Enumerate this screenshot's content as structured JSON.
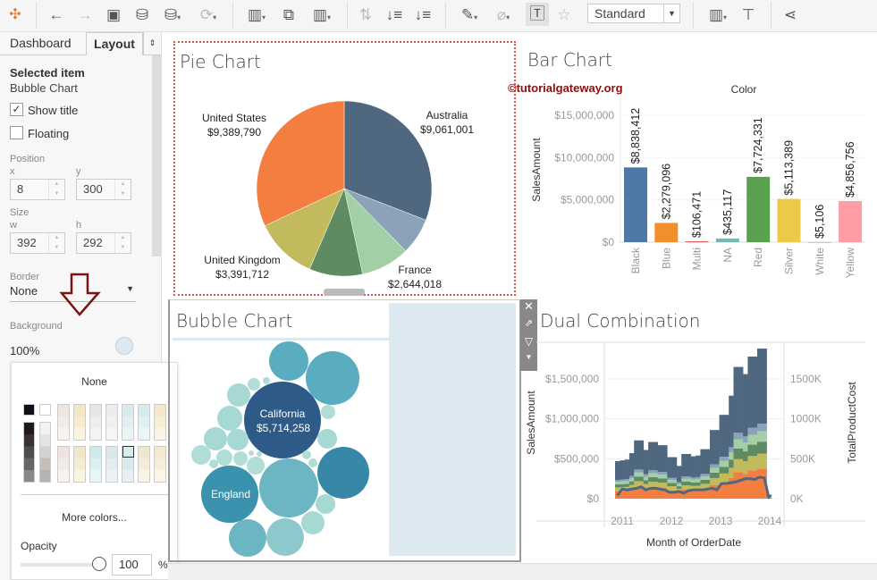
{
  "toolbar": {
    "view_mode": "Standard",
    "icons": [
      "tableau-logo",
      "back",
      "forward",
      "save",
      "new-datasource",
      "pause-updates",
      "refresh",
      "new-worksheet",
      "duplicate",
      "clear",
      "swap",
      "sort-asc",
      "sort-desc",
      "highlight",
      "annotate",
      "show-labels",
      "pin",
      "show-me",
      "presentation",
      "share"
    ]
  },
  "left_panel": {
    "tabs": [
      "Dashboard",
      "Layout"
    ],
    "selected_label": "Selected item",
    "selected_value": "Bubble Chart",
    "show_title": "Show title",
    "show_title_checked": true,
    "floating": "Floating",
    "floating_checked": false,
    "position_label": "Position",
    "x_label": "x",
    "y_label": "y",
    "x": "8",
    "y": "300",
    "size_label": "Size",
    "w_label": "w",
    "h_label": "h",
    "w": "392",
    "h": "292",
    "border_label": "Border",
    "border_value": "None",
    "background_label": "Background",
    "background_value": "100%",
    "background_color": "#dde9f0"
  },
  "color_popup": {
    "none": "None",
    "more_colors": "More colors...",
    "opacity_label": "Opacity",
    "opacity_value": "100",
    "opacity_unit": "%",
    "opacity_fraction": 1.0
  },
  "pie": {
    "title": "Pie Chart",
    "labels": [
      {
        "name": "Australia",
        "value": "$9,061,001"
      },
      {
        "name": "United States",
        "value": "$9,389,790"
      },
      {
        "name": "United Kingdom",
        "value": "$3,391,712"
      },
      {
        "name": "France",
        "value": "$2,644,018"
      }
    ]
  },
  "bar": {
    "title": "Bar Chart",
    "watermark": "©tutorialgateway.org"
  },
  "bubble": {
    "title": "Bubble Chart",
    "california": "California",
    "california_value": "$5,714,258",
    "england": "England"
  },
  "dual": {
    "title": "Dual Combination"
  },
  "chart_data": [
    {
      "type": "pie",
      "title": "Pie Chart",
      "slices": [
        {
          "label": "Australia",
          "value": 9061001,
          "color": "#4f6880"
        },
        {
          "label": "",
          "value": 1980000,
          "color": "#8ca2b9"
        },
        {
          "label": "France",
          "value": 2644018,
          "color": "#a2cfa6"
        },
        {
          "label": "",
          "value": 2890000,
          "color": "#5e8b62"
        },
        {
          "label": "United Kingdom",
          "value": 3391712,
          "color": "#c2bb5d"
        },
        {
          "label": "United States",
          "value": 9389790,
          "color": "#f47e3f"
        }
      ]
    },
    {
      "type": "bar",
      "title": "Bar Chart",
      "xlabel": "Color",
      "ylabel": "SalesAmount",
      "ylim": [
        0,
        16500000
      ],
      "yticks": [
        {
          "v": 0,
          "t": "$0"
        },
        {
          "v": 5000000,
          "t": "$5,000,000"
        },
        {
          "v": 10000000,
          "t": "$10,000,000"
        },
        {
          "v": 15000000,
          "t": "$15,000,000"
        }
      ],
      "categories": [
        "Black",
        "Blue",
        "Multi",
        "NA",
        "Red",
        "Silver",
        "White",
        "Yellow"
      ],
      "values": [
        8838412,
        2279096,
        106471,
        435117,
        7724331,
        5113389,
        5106,
        4856756
      ],
      "labels": [
        "$8,838,412",
        "$2,279,096",
        "$106,471",
        "$435,117",
        "$7,724,331",
        "$5,113,389",
        "$5,106",
        "$4,856,756"
      ],
      "colors": [
        "#4e79a7",
        "#f28e2b",
        "#e15759",
        "#76b7b2",
        "#59a14f",
        "#edc948",
        "#b07aa1",
        "#ff9da7"
      ]
    },
    {
      "type": "area",
      "title": "Dual Combination",
      "xlabel": "Month of OrderDate",
      "ylabel": "SalesAmount",
      "ylabel2": "TotalProductCost",
      "xticks": [
        "2011",
        "2012",
        "2013",
        "2014"
      ],
      "yticks": [
        {
          "v": 0,
          "t": "$0"
        },
        {
          "v": 500000,
          "t": "$500,000"
        },
        {
          "v": 1000000,
          "t": "$1,000,000"
        },
        {
          "v": 1500000,
          "t": "$1,500,000"
        }
      ],
      "yticks2": [
        {
          "v": 0,
          "t": "0K"
        },
        {
          "v": 500,
          "t": "500K"
        },
        {
          "v": 1000,
          "t": "1000K"
        },
        {
          "v": 1500,
          "t": "1500K"
        }
      ],
      "totals_millions": [
        0.47,
        0.48,
        0.49,
        0.57,
        0.73,
        0.73,
        0.61,
        0.71,
        0.71,
        0.67,
        0.67,
        0.52,
        0.52,
        0.41,
        0.56,
        0.56,
        0.53,
        0.54,
        0.62,
        0.62,
        0.86,
        0.86,
        1.05,
        1.05,
        1.29,
        1.65,
        1.65,
        1.56,
        1.78,
        1.78,
        1.88,
        1.88,
        0.05
      ],
      "layers": [
        {
          "share": 0.2,
          "color": "#f47e3f"
        },
        {
          "share": 0.1,
          "color": "#c2bb5d"
        },
        {
          "share": 0.08,
          "color": "#5e8b62"
        },
        {
          "share": 0.07,
          "color": "#a2cfa6"
        },
        {
          "share": 0.05,
          "color": "#8ca2b9"
        },
        {
          "share": 0.5,
          "color": "#4f6880"
        }
      ],
      "cost_line_k": [
        40,
        120,
        110,
        120,
        130,
        150,
        110,
        130,
        130,
        120,
        110,
        80,
        80,
        90,
        70,
        100,
        110,
        110,
        110,
        120,
        130,
        110,
        190,
        190,
        200,
        210,
        230,
        250,
        250,
        240,
        270,
        260,
        0
      ],
      "line_color": "#4f6880"
    }
  ]
}
